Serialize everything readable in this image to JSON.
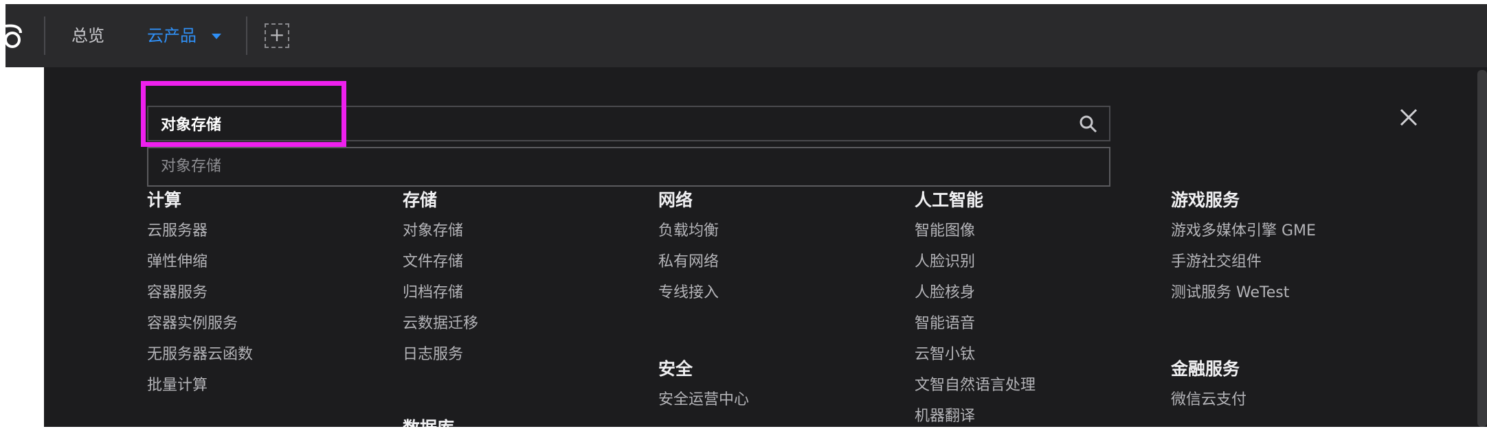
{
  "topbar": {
    "nav": [
      {
        "label": "总览"
      },
      {
        "label": "云产品"
      }
    ]
  },
  "search": {
    "value": "对象存储",
    "suggestion": "对象存储"
  },
  "categories": [
    {
      "title": "计算",
      "items": [
        "云服务器",
        "弹性伸缩",
        "容器服务",
        "容器实例服务",
        "无服务器云函数",
        "批量计算"
      ]
    },
    {
      "title": "存储",
      "items": [
        "对象存储",
        "文件存储",
        "归档存储",
        "云数据迁移",
        "日志服务"
      ]
    },
    {
      "title": "数据库",
      "items": []
    },
    {
      "title": "网络",
      "items": [
        "负载均衡",
        "私有网络",
        "专线接入"
      ]
    },
    {
      "title": "安全",
      "items": [
        "安全运营中心"
      ]
    },
    {
      "title": "人工智能",
      "items": [
        "智能图像",
        "人脸识别",
        "人脸核身",
        "智能语音",
        "云智小钛",
        "文智自然语言处理",
        "机器翻译"
      ]
    },
    {
      "title": "游戏服务",
      "items": [
        "游戏多媒体引擎 GME",
        "手游社交组件",
        "测试服务 WeTest"
      ]
    },
    {
      "title": "金融服务",
      "items": [
        "微信云支付"
      ]
    }
  ],
  "colors": {
    "accent": "#2f8ff5",
    "highlight": "#ee20ee",
    "background": "#1c1c1e",
    "topbar": "#2a2a2c"
  },
  "icons": {
    "logo": "cloud-logo-icon",
    "add": "add-icon",
    "search": "search-icon",
    "close": "close-icon",
    "dropdown": "caret-down-icon"
  }
}
